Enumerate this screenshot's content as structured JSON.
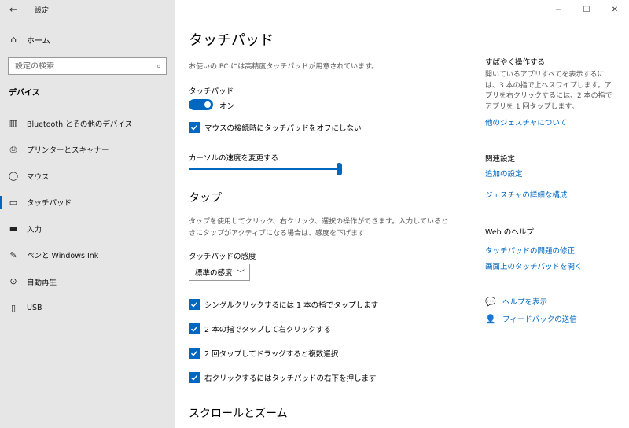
{
  "sidebar": {
    "app_title": "設定",
    "back_icon": "←",
    "home": {
      "icon": "⌂",
      "label": "ホーム"
    },
    "search": {
      "placeholder": "設定の検索",
      "icon": "⌕"
    },
    "section_title": "デバイス",
    "items": [
      {
        "icon": "bluetooth-icon",
        "glyph": "▥",
        "label": "Bluetooth とその他のデバイス"
      },
      {
        "icon": "printer-icon",
        "glyph": "⎙",
        "label": "プリンターとスキャナー"
      },
      {
        "icon": "mouse-icon",
        "glyph": "◯",
        "label": "マウス"
      },
      {
        "icon": "touchpad-icon",
        "glyph": "▭",
        "label": "タッチパッド"
      },
      {
        "icon": "keyboard-icon",
        "glyph": "▬",
        "label": "入力"
      },
      {
        "icon": "pen-icon",
        "glyph": "✎",
        "label": "ペンと Windows Ink"
      },
      {
        "icon": "autoplay-icon",
        "glyph": "⊙",
        "label": "自動再生"
      },
      {
        "icon": "usb-icon",
        "glyph": "▯",
        "label": "USB"
      }
    ],
    "active_index": 3
  },
  "window": {
    "minimize": "−",
    "maximize": "☐",
    "close": "✕"
  },
  "main": {
    "title": "タッチパッド",
    "description": "お使いの PC には高精度タッチパッドが用意されています。",
    "touchpad_label": "タッチパッド",
    "toggle_state": "オン",
    "mouse_checkbox": "マウスの接続時にタッチパッドをオフにしない",
    "cursor_speed_label": "カーソルの速度を変更する",
    "cursor_speed_value": 1.0,
    "tap_heading": "タップ",
    "tap_description": "タップを使用してクリック、右クリック、選択の操作ができます。入力しているときにタップがアクティブになる場合は、感度を下げます",
    "sensitivity_label": "タッチパッドの感度",
    "sensitivity_value": "標準の感度",
    "tap_options": [
      "シングルクリックするには 1 本の指でタップします",
      "2 本の指でタップして右クリックする",
      "2 回タップしてドラッグすると複数選択",
      "右クリックするにはタッチパッドの右下を押します"
    ],
    "scroll_heading": "スクロールとズーム"
  },
  "right": {
    "quick_title": "すばやく操作する",
    "quick_text": "開いているアプリすべてを表示するには、3 本の指で上へスワイプします。アプリを右クリックするには、2 本の指でアプリを 1 回タップします。",
    "gestures_link": "他のジェスチャについて",
    "related_title": "関連設定",
    "additional_link": "追加の設定",
    "gesture_config_link": "ジェスチャの詳細な構成",
    "web_help_title": "Web のヘルプ",
    "fix_link": "タッチパッドの問題の修正",
    "onscreen_link": "画面上のタッチパッドを開く",
    "help_link": "ヘルプを表示",
    "feedback_link": "フィードバックの送信"
  },
  "colors": {
    "accent": "#0067c0",
    "sidebar_bg": "#e6e6e6"
  }
}
